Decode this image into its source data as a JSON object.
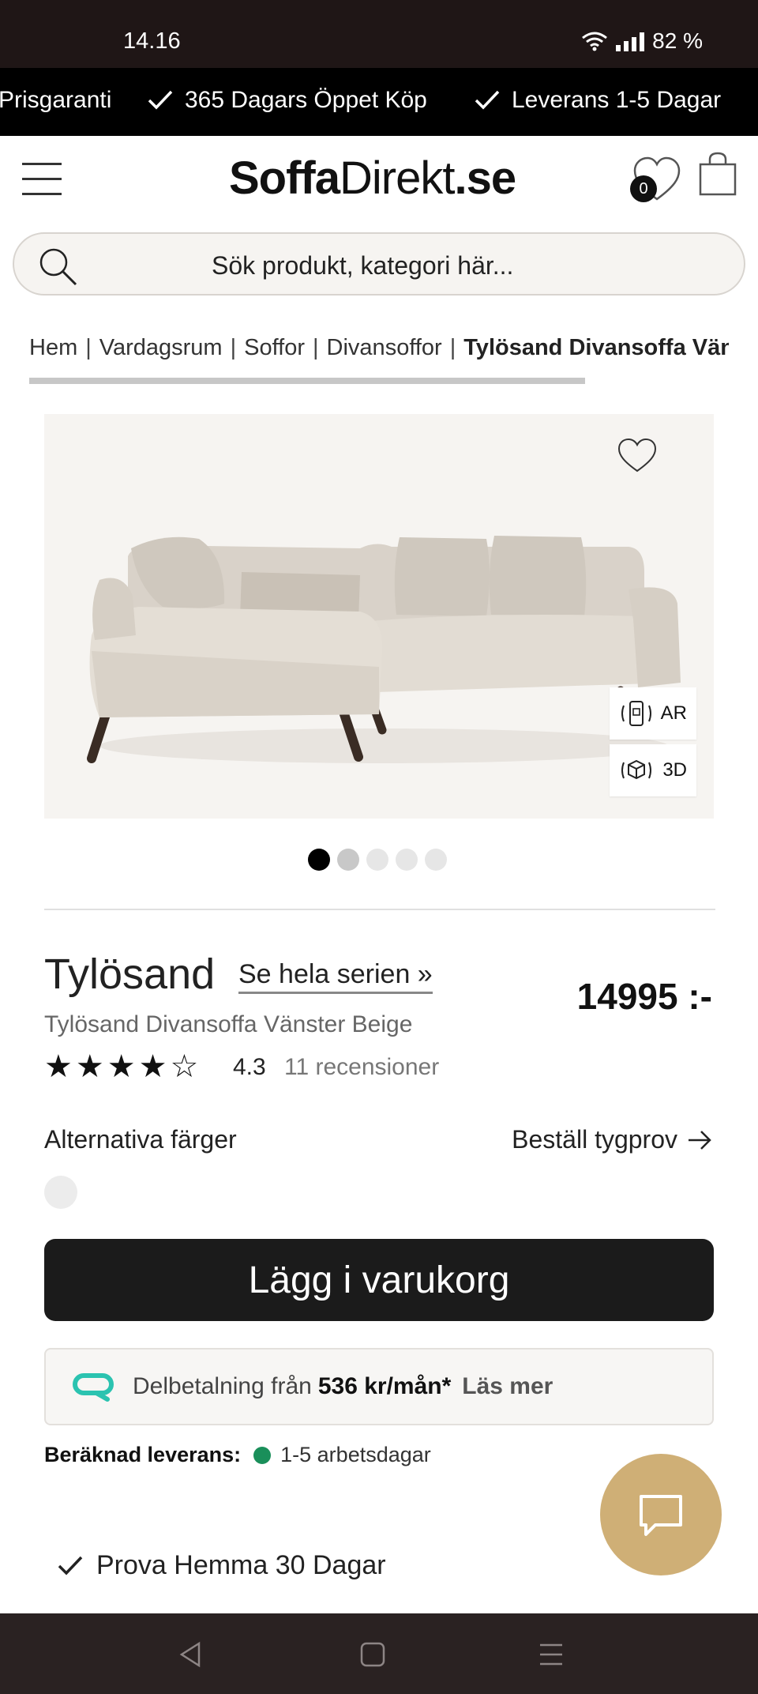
{
  "status_bar": {
    "time": "14.16",
    "battery": "82 %"
  },
  "promo": {
    "items": [
      "Prisgaranti",
      "365 Dagars Öppet Köp",
      "Leverans 1-5 Dagar"
    ]
  },
  "header": {
    "logo_bold": "Soffa",
    "logo_regular": "Direkt",
    "logo_suffix": ".se",
    "wishlist_count": "0"
  },
  "search": {
    "placeholder": "Sök produkt, kategori här..."
  },
  "breadcrumb": {
    "items": [
      "Hem",
      "Vardagsrum",
      "Soffor",
      "Divansoffor"
    ],
    "current": "Tylösand Divansoffa Vänster Beige"
  },
  "gallery": {
    "ar_label": "AR",
    "d3_label": "3D",
    "dot_count": 5,
    "active_index": 0
  },
  "product": {
    "title": "Tylösand",
    "series_link": "Se hela serien »",
    "price": "14995 :-",
    "subtitle": "Tylösand Divansoffa Vänster Beige",
    "rating": "4.3",
    "reviews": "11 recensioner",
    "stars": "4 of 5 full"
  },
  "options": {
    "alt_colors_label": "Alternativa färger",
    "fabric_sample_label": "Beställ tygprov"
  },
  "cart": {
    "label": "Lägg i varukorg"
  },
  "finance": {
    "prefix": "Delbetalning från",
    "amount": "536 kr/mån*",
    "read_more": "Läs mer"
  },
  "delivery": {
    "label": "Beräknad leverans:",
    "value": "1-5 arbetsdagar",
    "status_color": "#1a8f5a"
  },
  "usp": {
    "try_home": "Prova Hemma 30 Dagar"
  },
  "colors": {
    "accent_chat": "#cfaf76",
    "cart_bg": "#1b1b1b"
  }
}
